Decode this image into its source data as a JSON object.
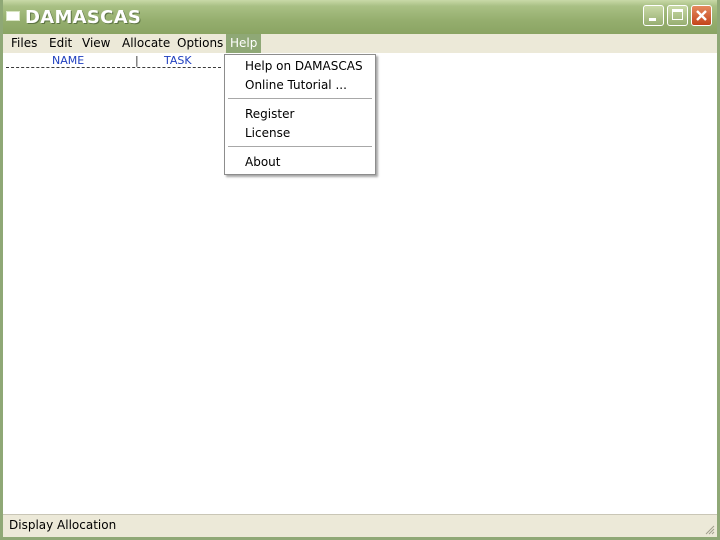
{
  "window": {
    "title": "DAMASCAS",
    "title_gradient": [
      "#c9d9a8",
      "#8aa463"
    ],
    "close_color": "#c4441b"
  },
  "menubar": {
    "items": [
      "Files",
      "Edit",
      "View",
      "Allocate",
      "Options",
      "Help"
    ],
    "active": "Help",
    "active_color": "#8fa876"
  },
  "list": {
    "columns": [
      "NAME",
      "TASK"
    ],
    "separator": "|",
    "header_color": "#1f3fbf"
  },
  "help_menu": {
    "items": [
      "Help on DAMASCAS",
      "Online Tutorial ...",
      "Register",
      "License",
      "About"
    ]
  },
  "statusbar": {
    "text": "Display Allocation"
  }
}
